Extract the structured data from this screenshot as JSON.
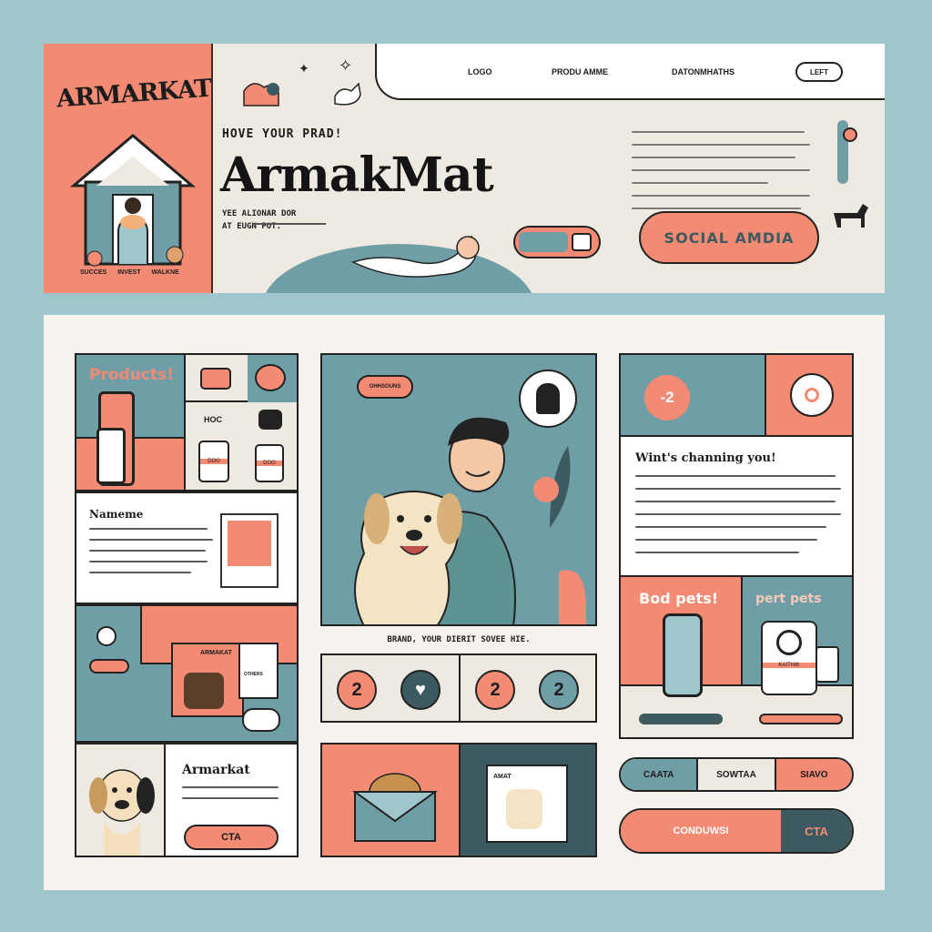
{
  "header": {
    "side_logo": "ARMARKAT",
    "side_logo_sub": "",
    "side_footer": [
      "SUCCES",
      "INVEST",
      "WALKNE"
    ],
    "nav": {
      "items": [
        "LOGO",
        "PRODU AMME",
        "DATONMHATHS"
      ],
      "button": "LEFT"
    },
    "tagline": "HOVE YOUR PRAD!",
    "brand": "ArmakMat",
    "sub_line_1": "YEE ALIONAR DOR",
    "sub_line_2": "AT EUGN POT.",
    "social_button": "SOCIAL AMDIA"
  },
  "left_column": {
    "products_title": "Products!",
    "hoc_label": "HOC",
    "jar_label_1": "DOG",
    "jar_label_2": "DOG",
    "name_title": "Nameme",
    "card_title": "ARMAKAT",
    "card_sub": "OTHERS",
    "brand_title": "Armarkat",
    "cta": "CTA"
  },
  "center_column": {
    "bubble": "OHHSOUNS",
    "caption": "BRAND, YOUR DIERIT SOVEE HIE.",
    "stat_left": "2",
    "stat_mid": "2",
    "stat_right": "2",
    "mail_label": "AMAT"
  },
  "right_column": {
    "discount": "-2",
    "heading": "Wint's channing you!",
    "best_pets": "Bod pets!",
    "pert_pets": "pert pets",
    "jar_label": "KAITHIK",
    "tabs": [
      "CAATA",
      "SOWTAA",
      "SIAVO"
    ],
    "footer_left": "CONDUWSI",
    "footer_right": "CTA"
  },
  "icons": {
    "accent": "#f28a74",
    "teal": "#6f9ea6",
    "cream": "#eeeae2",
    "dark": "#3c5a60"
  }
}
